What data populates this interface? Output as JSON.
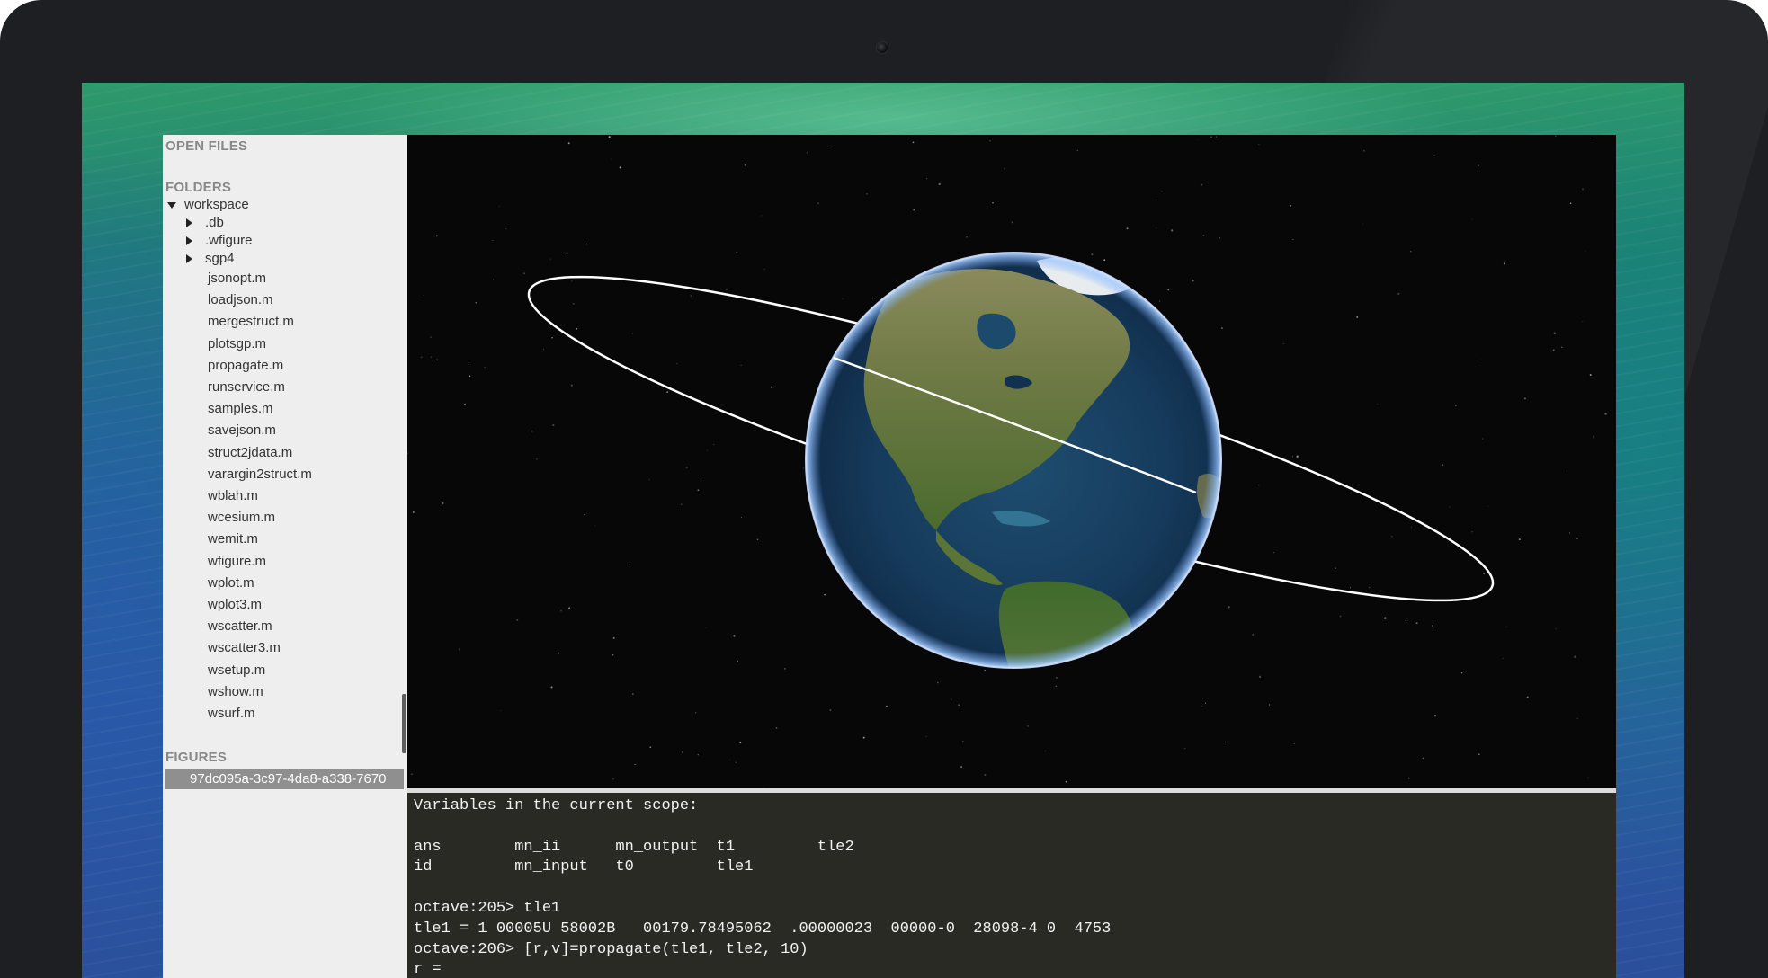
{
  "sidebar": {
    "open_files_title": "OPEN FILES",
    "folders_title": "FOLDERS",
    "root_folder": "workspace",
    "subfolders": [
      ".db",
      ".wfigure",
      "sgp4"
    ],
    "files": [
      "jsonopt.m",
      "loadjson.m",
      "mergestruct.m",
      "plotsgp.m",
      "propagate.m",
      "runservice.m",
      "samples.m",
      "savejson.m",
      "struct2jdata.m",
      "varargin2struct.m",
      "wblah.m",
      "wcesium.m",
      "wemit.m",
      "wfigure.m",
      "wplot.m",
      "wplot3.m",
      "wscatter.m",
      "wscatter3.m",
      "wsetup.m",
      "wshow.m",
      "wsurf.m"
    ],
    "figures_title": "FIGURES",
    "figures": [
      "97dc095a-3c97-4da8-a338-7670"
    ]
  },
  "console": {
    "lines": [
      "Variables in the current scope:",
      "",
      "ans        mn_ii      mn_output  t1         tle2",
      "id         mn_input   t0         tle1",
      "",
      "octave:205> tle1",
      "tle1 = 1 00005U 58002B   00179.78495062  .00000023  00000-0  28098-4 0  4753",
      "octave:206> [r,v]=propagate(tle1, tle2, 10)",
      "r ="
    ]
  },
  "colors": {
    "sidebar_bg": "#eeeeee",
    "viewer_bg": "#070707",
    "console_bg": "#2a2a24",
    "figure_selected_bg": "#8f8f8f",
    "orbit": "#ffffff"
  }
}
